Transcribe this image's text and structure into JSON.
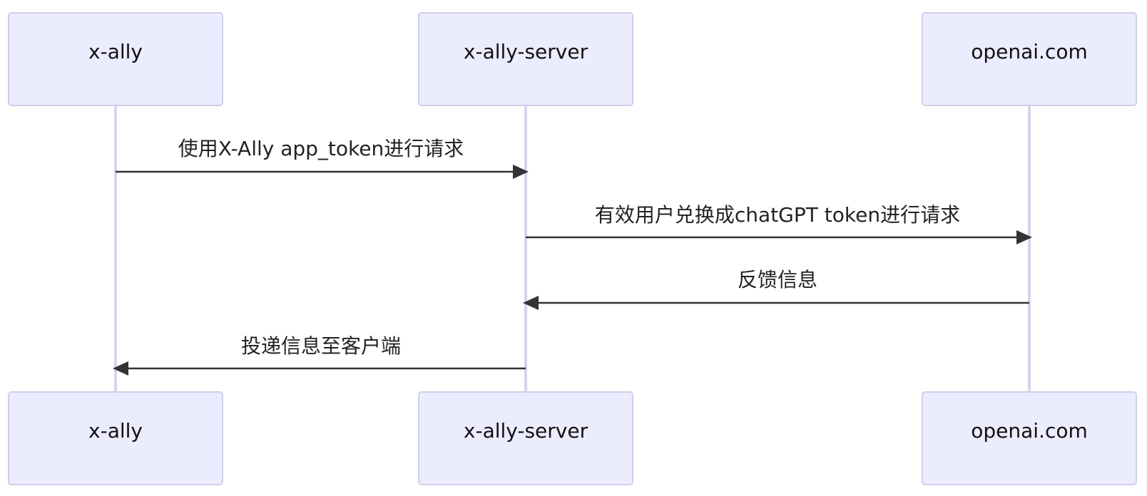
{
  "actors": [
    {
      "id": "x_ally",
      "label": "x-ally"
    },
    {
      "id": "x_ally_server",
      "label": "x-ally-server"
    },
    {
      "id": "openai",
      "label": "openai.com"
    }
  ],
  "messages": [
    {
      "from": 0,
      "to": 1,
      "label": "使用X-Ally app_token进行请求"
    },
    {
      "from": 1,
      "to": 2,
      "label": "有效用户兑换成chatGPT token进行请求"
    },
    {
      "from": 2,
      "to": 1,
      "label": "反馈信息"
    },
    {
      "from": 1,
      "to": 0,
      "label": "投递信息至客户端"
    }
  ]
}
